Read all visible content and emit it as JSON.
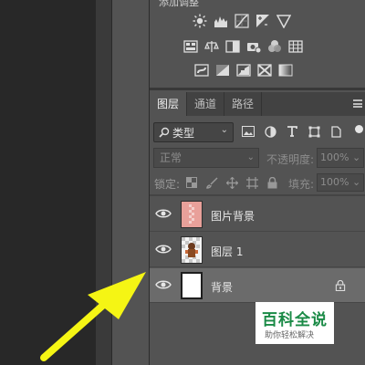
{
  "adjustments": {
    "title": "添加调整"
  },
  "tabs": [
    {
      "label": "图层",
      "active": true
    },
    {
      "label": "通道",
      "active": false
    },
    {
      "label": "路径",
      "active": false
    }
  ],
  "filter": {
    "kind_label": "类型"
  },
  "blend": {
    "mode": "正常",
    "opacity_label": "不透明度:",
    "opacity_value": "100%"
  },
  "lock": {
    "label": "锁定:",
    "fill_label": "填充:",
    "fill_value": "100%"
  },
  "layers": [
    {
      "name": "图片背景",
      "visible": true,
      "selected": false,
      "locked": false,
      "thumb": "pink-checker-person"
    },
    {
      "name": "图层 1",
      "visible": true,
      "selected": false,
      "locked": false,
      "thumb": "checker-person"
    },
    {
      "name": "背景",
      "visible": true,
      "selected": true,
      "locked": true,
      "thumb": "white"
    }
  ],
  "watermark": {
    "title": "百科全说",
    "subtitle": "助你轻松解决"
  },
  "colors": {
    "accent_arrow": "#f5f514",
    "watermark_green": "#1a8a46",
    "selected_layer": "#6b6b6b"
  }
}
